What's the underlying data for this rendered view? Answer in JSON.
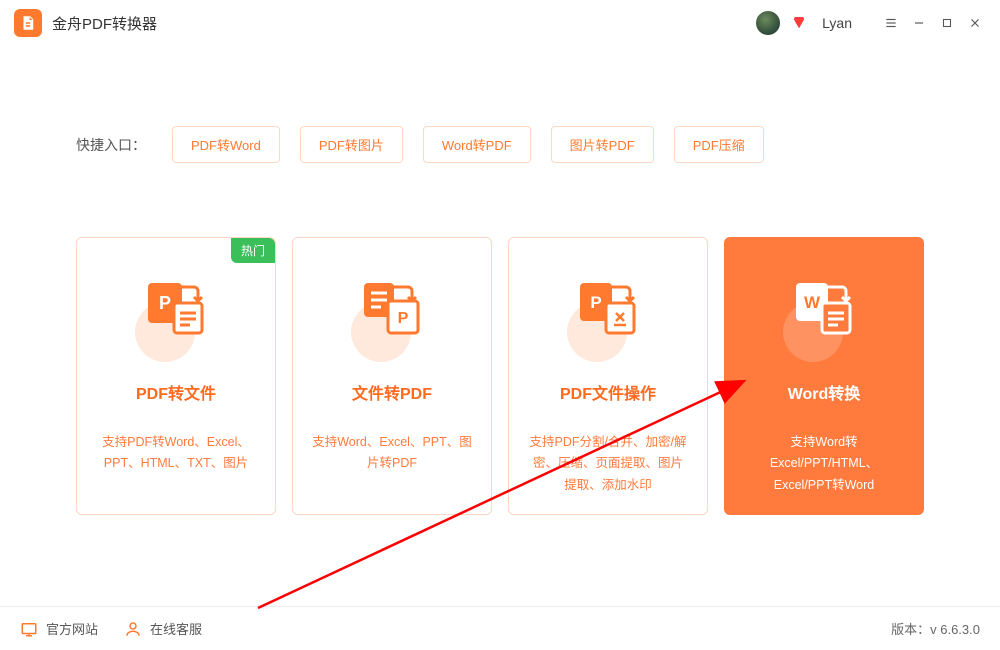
{
  "app": {
    "title": "金舟PDF转换器",
    "username": "Lyan"
  },
  "quick": {
    "label": "快捷入口：",
    "items": [
      "PDF转Word",
      "PDF转图片",
      "Word转PDF",
      "图片转PDF",
      "PDF压缩"
    ]
  },
  "cards": [
    {
      "badge": "热门",
      "title": "PDF转文件",
      "desc": "支持PDF转Word、Excel、PPT、HTML、TXT、图片"
    },
    {
      "title": "文件转PDF",
      "desc": "支持Word、Excel、PPT、图片转PDF"
    },
    {
      "title": "PDF文件操作",
      "desc": "支持PDF分割/合并、加密/解密、压缩、页面提取、图片提取、添加水印"
    },
    {
      "title": "Word转换",
      "desc": "支持Word转Excel/PPT/HTML、Excel/PPT转Word",
      "active": true
    }
  ],
  "footer": {
    "website": "官方网站",
    "support": "在线客服",
    "version_label": "版本：",
    "version": "v 6.6.3.0"
  }
}
